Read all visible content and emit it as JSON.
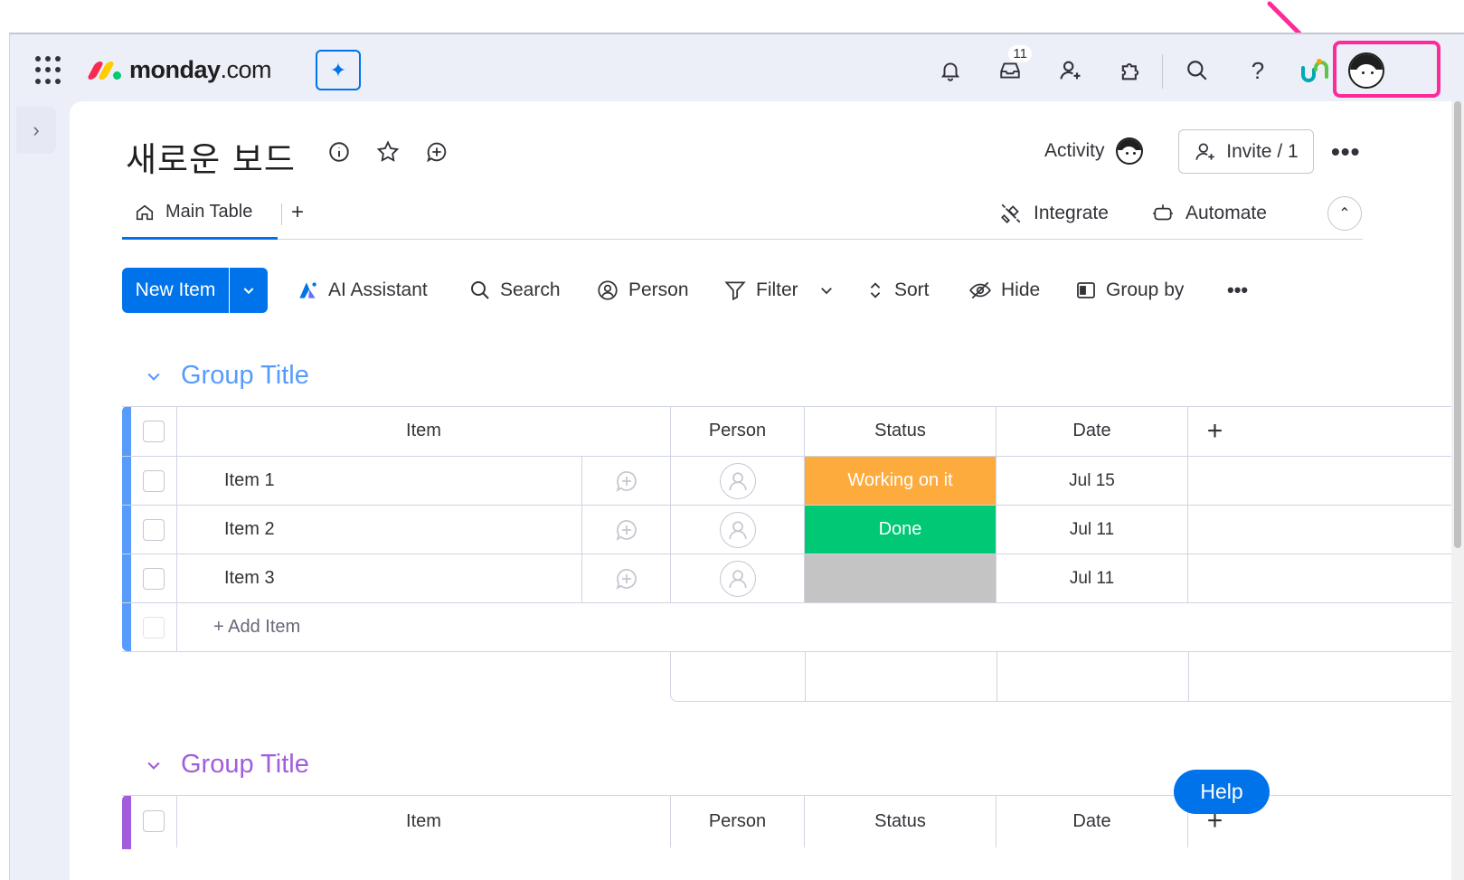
{
  "header": {
    "logo_brand": "monday",
    "logo_suffix": ".com",
    "notification_badge": "11",
    "help_label": "?",
    "colors": {
      "accent": "#0073ea",
      "highlight": "#ff2a9a"
    }
  },
  "board": {
    "title": "새로운 보드",
    "activity_label": "Activity",
    "invite_label": "Invite / 1",
    "more_label": "•••"
  },
  "tabs": {
    "main_label": "Main Table",
    "add_label": "+",
    "integrate_label": "Integrate",
    "automate_label": "Automate"
  },
  "toolbar": {
    "new_item_label": "New Item",
    "ai_assistant_label": "AI Assistant",
    "search_label": "Search",
    "person_label": "Person",
    "filter_label": "Filter",
    "sort_label": "Sort",
    "hide_label": "Hide",
    "group_by_label": "Group by",
    "more_label": "•••"
  },
  "groups": [
    {
      "title": "Group Title",
      "color": "#579bfc",
      "columns": {
        "item": "Item",
        "person": "Person",
        "status": "Status",
        "date": "Date",
        "add": "+"
      },
      "rows": [
        {
          "name": "Item 1",
          "status": "Working on it",
          "status_color": "#fdab3d",
          "date": "Jul 15"
        },
        {
          "name": "Item 2",
          "status": "Done",
          "status_color": "#00c875",
          "date": "Jul 11"
        },
        {
          "name": "Item 3",
          "status": "",
          "status_color": "#c4c4c4",
          "date": "Jul 11"
        }
      ],
      "add_item_label": "+ Add Item"
    },
    {
      "title": "Group Title",
      "color": "#a25ddc",
      "columns": {
        "item": "Item",
        "person": "Person",
        "status": "Status",
        "date": "Date",
        "add": "+"
      }
    }
  ],
  "help_button_label": "Help"
}
